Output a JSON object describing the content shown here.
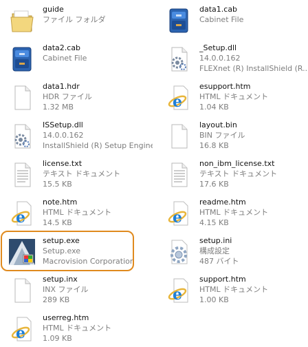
{
  "files": [
    {
      "name": "guide",
      "type": "ファイル フォルダ",
      "detail": "",
      "icon": "folder-icon"
    },
    {
      "name": "data1.cab",
      "type": "Cabinet File",
      "detail": "",
      "icon": "cabinet-icon"
    },
    {
      "name": "data2.cab",
      "type": "Cabinet File",
      "detail": "",
      "icon": "cabinet-icon"
    },
    {
      "name": "_Setup.dll",
      "type": "14.0.0.162",
      "detail": "FLEXnet (R) InstallShield (R...",
      "icon": "dll-gear-icon"
    },
    {
      "name": "data1.hdr",
      "type": "HDR ファイル",
      "detail": "1.32 MB",
      "icon": "blank-file-icon"
    },
    {
      "name": "esupport.htm",
      "type": "HTML ドキュメント",
      "detail": "1.04 KB",
      "icon": "ie-document-icon"
    },
    {
      "name": "ISSetup.dll",
      "type": "14.0.0.162",
      "detail": "InstallShield (R) Setup Engine",
      "icon": "dll-gear-icon"
    },
    {
      "name": "layout.bin",
      "type": "BIN ファイル",
      "detail": "16.8 KB",
      "icon": "blank-file-icon"
    },
    {
      "name": "license.txt",
      "type": "テキスト ドキュメント",
      "detail": "15.5 KB",
      "icon": "text-file-icon"
    },
    {
      "name": "non_ibm_license.txt",
      "type": "テキスト ドキュメント",
      "detail": "17.6 KB",
      "icon": "text-file-icon"
    },
    {
      "name": "note.htm",
      "type": "HTML ドキュメント",
      "detail": "14.5 KB",
      "icon": "ie-document-icon"
    },
    {
      "name": "readme.htm",
      "type": "HTML ドキュメント",
      "detail": "4.15 KB",
      "icon": "ie-document-icon"
    },
    {
      "name": "setup.exe",
      "type": "Setup.exe",
      "detail": "Macrovision Corporation",
      "icon": "installer-icon"
    },
    {
      "name": "setup.ini",
      "type": "構成設定",
      "detail": "487 バイト",
      "icon": "ini-gear-icon"
    },
    {
      "name": "setup.inx",
      "type": "INX ファイル",
      "detail": "289 KB",
      "icon": "blank-file-icon"
    },
    {
      "name": "support.htm",
      "type": "HTML ドキュメント",
      "detail": "1.00 KB",
      "icon": "ie-document-icon"
    },
    {
      "name": "userreg.htm",
      "type": "HTML ドキュメント",
      "detail": "1.09 KB",
      "icon": "ie-document-icon"
    }
  ],
  "colors": {
    "highlight": "#e08a1e",
    "secondary_text": "#7d7d7d",
    "ie_blue": "#1f7fd6"
  }
}
